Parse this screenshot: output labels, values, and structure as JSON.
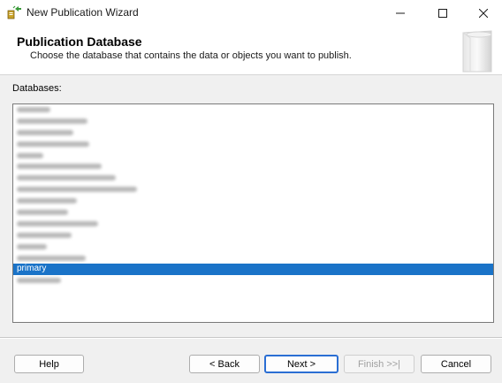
{
  "window": {
    "title": "New Publication Wizard"
  },
  "header": {
    "title": "Publication Database",
    "subtitle": "Choose the database that contains the data or objects you want to publish."
  },
  "databases": {
    "label": "Databases:",
    "selected": "primary"
  },
  "buttons": {
    "help": "Help",
    "back": "< Back",
    "next": "Next >",
    "finish": "Finish >>|",
    "cancel": "Cancel"
  }
}
